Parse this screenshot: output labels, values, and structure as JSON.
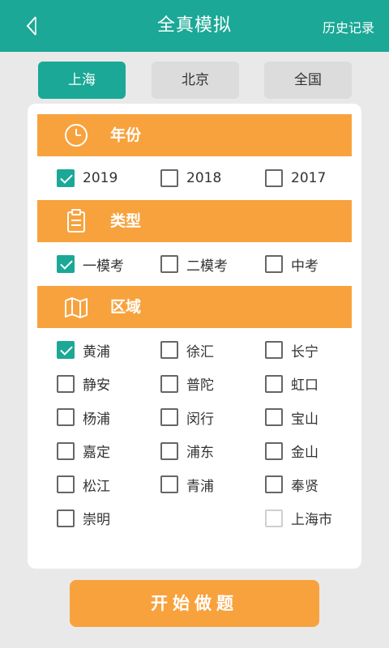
{
  "header": {
    "title": "全真模拟",
    "history_label": "历史记录",
    "back_icon": "back-arrow-icon"
  },
  "tabs": [
    {
      "label": "上海",
      "active": true
    },
    {
      "label": "北京",
      "active": false
    },
    {
      "label": "全国",
      "active": false
    }
  ],
  "sections": {
    "year": {
      "title": "年份",
      "icon": "clock-icon",
      "options": [
        {
          "label": "2019",
          "checked": true
        },
        {
          "label": "2018",
          "checked": false
        },
        {
          "label": "2017",
          "checked": false
        }
      ]
    },
    "type": {
      "title": "类型",
      "icon": "clipboard-icon",
      "options": [
        {
          "label": "一模考",
          "checked": true
        },
        {
          "label": "二模考",
          "checked": false
        },
        {
          "label": "中考",
          "checked": false
        }
      ]
    },
    "region": {
      "title": "区域",
      "icon": "map-icon",
      "options": [
        {
          "label": "黄浦",
          "checked": true
        },
        {
          "label": "徐汇",
          "checked": false
        },
        {
          "label": "长宁",
          "checked": false
        },
        {
          "label": "静安",
          "checked": false
        },
        {
          "label": "普陀",
          "checked": false
        },
        {
          "label": "虹口",
          "checked": false
        },
        {
          "label": "杨浦",
          "checked": false
        },
        {
          "label": "闵行",
          "checked": false
        },
        {
          "label": "宝山",
          "checked": false
        },
        {
          "label": "嘉定",
          "checked": false
        },
        {
          "label": "浦东",
          "checked": false
        },
        {
          "label": "金山",
          "checked": false
        },
        {
          "label": "松江",
          "checked": false
        },
        {
          "label": "青浦",
          "checked": false
        },
        {
          "label": "奉贤",
          "checked": false
        },
        {
          "label": "崇明",
          "checked": false
        },
        {
          "label": "上海市",
          "checked": false,
          "disabled": true
        }
      ]
    }
  },
  "start_button": {
    "label": "开始做题"
  },
  "colors": {
    "primary": "#1ba896",
    "accent": "#f8a23d",
    "background": "#e9e9e9"
  }
}
